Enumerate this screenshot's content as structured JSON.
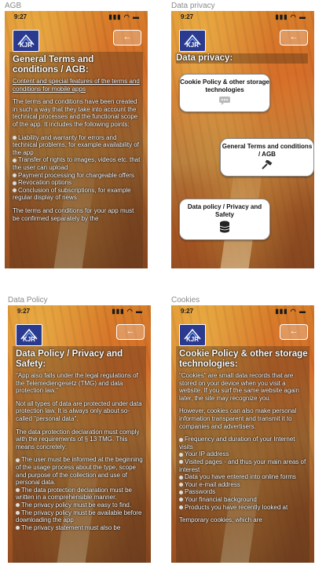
{
  "frames": [
    {
      "label": "AGB",
      "time": "9:27",
      "title": "General Terms and conditions / AGB:",
      "subtitle": "Content and special features of the terms and conditions for mobile apps",
      "paragraphs": [
        "The terms and conditions have been created in such a way that they take into account the technical processes and the functional scope of the app. It includes the following points:"
      ],
      "bullets": [
        "Liability and warranty for errors and technical problems, for example availability of the app",
        "Transfer of rights to images, videos etc. that the user can upload",
        "Payment processing for chargeable offers",
        "Revocation options",
        "Conclusion of subscriptions, for example regular display of news"
      ],
      "footer": "The terms and conditions for your app must be confirmed separately by the"
    },
    {
      "label": "Data privacy",
      "time": "9:27",
      "title": "Data privacy:",
      "cards": [
        {
          "label": "Cookie Policy & other storage technologies",
          "icon": "chat-bubble-icon"
        },
        {
          "label": "General Terms and conditions / AGB",
          "icon": "gavel-icon"
        },
        {
          "label": "Data policy / Privacy and Safety",
          "icon": "database-icon"
        }
      ]
    },
    {
      "label": "Data Policy",
      "time": "9:27",
      "title": "Data Policy / Privacy and Safety:",
      "paragraphs": [
        "\"App also falls under the legal regulations of the Telemediengesetz (TMG) and data protection law.\"",
        "Not all types of data are protected under data protection law. It is always only about so-called \"personal data\".",
        "The data protection declaration must comply with the requirements of § 13 TMG. This means concretely:"
      ],
      "bullets": [
        "The user must be informed at the beginning of the usage process about the type, scope and purpose of the collection and use of personal data.",
        "The data protection declaration must be written in a comprehensible manner.",
        "The privacy policy must be easy to find.",
        "The privacy policy must be available before downloading the app",
        "The privacy statement must also be"
      ]
    },
    {
      "label": "Cookies",
      "time": "9:27",
      "title": "Cookie Policy & other storage technologies:",
      "paragraphs": [
        "\"Cookies\" are small data records that are stored on your device when you visit a website. If you surf the same website again later, the site may recognize you.",
        "However, cookies can also make personal information transparent and transmit it to companies and advertisers."
      ],
      "bullets": [
        "Frequency and duration of your Internet visits",
        "Your IP address",
        "Visited pages - and thus your main areas of interest",
        "Data you have entered into online forms",
        "Your e-mail address",
        "Passwords",
        "Your financial background",
        "Products you have recently looked at"
      ],
      "footer": "Temporary cookies, which are"
    }
  ],
  "icons": {
    "status": "signal-wifi-battery-icon",
    "back": "back-arrow-icon",
    "logo": "kjr-logo"
  },
  "colors": {
    "logo_bg": "#2a3b8f",
    "text": "#ffffff",
    "card_bg": "#ffffff"
  }
}
